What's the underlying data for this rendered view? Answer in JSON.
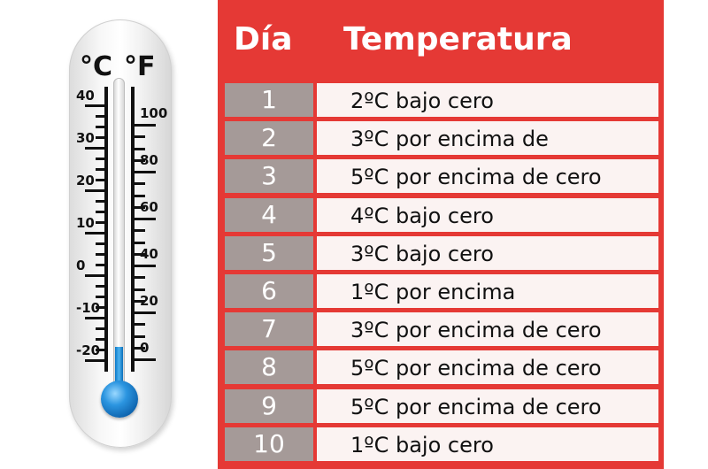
{
  "thermometer": {
    "celsius_unit": "°C",
    "fahrenheit_unit": "°F",
    "celsius_labels": [
      "40",
      "30",
      "20",
      "10",
      "0",
      "-10",
      "-20"
    ],
    "fahrenheit_labels": [
      "100",
      "80",
      "60",
      "40",
      "20",
      "0"
    ],
    "fill_color": "#1e88e5"
  },
  "table": {
    "header_color": "#e53935",
    "headers": {
      "day": "Día",
      "temperature": "Temperatura"
    },
    "rows": [
      {
        "day": "1",
        "temperature": "2ºC bajo cero"
      },
      {
        "day": "2",
        "temperature": "3ºC por encima de"
      },
      {
        "day": "3",
        "temperature": "5ºC por encima de cero"
      },
      {
        "day": "4",
        "temperature": "4ºC bajo cero"
      },
      {
        "day": "5",
        "temperature": "3ºC bajo cero"
      },
      {
        "day": "6",
        "temperature": "1ºC por encima"
      },
      {
        "day": "7",
        "temperature": "3ºC por encima de cero"
      },
      {
        "day": "8",
        "temperature": "5ºC por encima de cero"
      },
      {
        "day": "9",
        "temperature": "5ºC por encima de cero"
      },
      {
        "day": "10",
        "temperature": "1ºC bajo cero"
      }
    ]
  }
}
